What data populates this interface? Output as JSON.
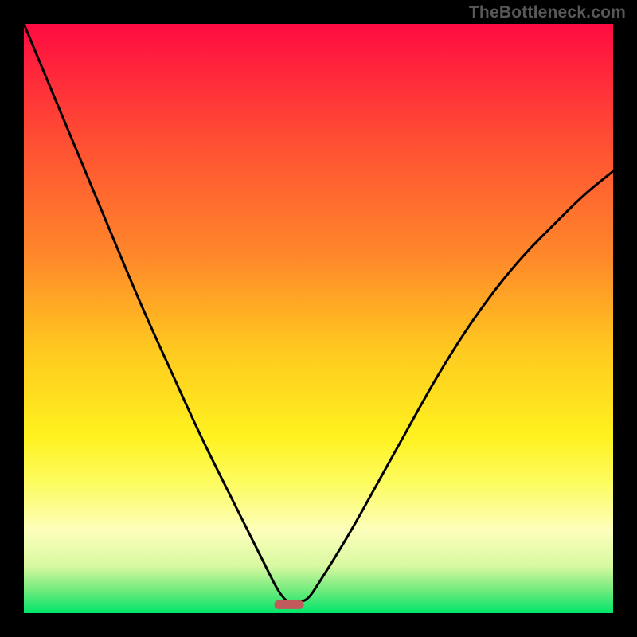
{
  "attribution": "TheBottleneck.com",
  "chart_data": {
    "type": "line",
    "title": "",
    "xlabel": "",
    "ylabel": "",
    "xlim": [
      0,
      100
    ],
    "ylim": [
      0,
      100
    ],
    "grid": false,
    "note": "Single unlabeled curve over a red-to-green vertical gradient background; values estimated from pixels as percentage of plot height from bottom.",
    "series": [
      {
        "name": "curve",
        "x": [
          0,
          5,
          10,
          15,
          20,
          25,
          30,
          35,
          40,
          44,
          46,
          48,
          50,
          55,
          60,
          65,
          70,
          75,
          80,
          85,
          90,
          95,
          100
        ],
        "y_percent": [
          100,
          88,
          76,
          64,
          52,
          41,
          30,
          20,
          10,
          2,
          2,
          2,
          5,
          13,
          22,
          31,
          40,
          48,
          55,
          61,
          66,
          71,
          75
        ]
      }
    ],
    "marker": {
      "center_x_percent": 45,
      "y_percent": 1.5,
      "width_percent": 5,
      "color": "#c15a5a"
    },
    "background_gradient_stops": [
      {
        "pos": 0,
        "color": "#ff0b42"
      },
      {
        "pos": 18,
        "color": "#ff4834"
      },
      {
        "pos": 40,
        "color": "#ff8a2a"
      },
      {
        "pos": 55,
        "color": "#ffc81f"
      },
      {
        "pos": 70,
        "color": "#fff21f"
      },
      {
        "pos": 78,
        "color": "#fdfc61"
      },
      {
        "pos": 86,
        "color": "#fdfebc"
      },
      {
        "pos": 92,
        "color": "#d8f9a0"
      },
      {
        "pos": 96,
        "color": "#74eb7e"
      },
      {
        "pos": 100,
        "color": "#00e56a"
      }
    ]
  }
}
